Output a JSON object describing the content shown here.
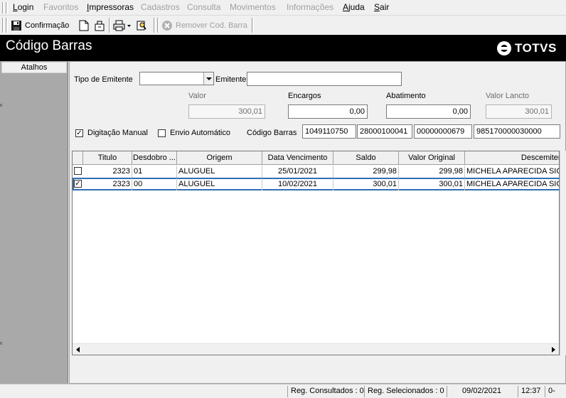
{
  "menu": {
    "items": [
      {
        "label": "Login",
        "underline": "L",
        "rest": "ogin",
        "enabled": true
      },
      {
        "label": "Favoritos",
        "enabled": false
      },
      {
        "label": "Impressoras",
        "underline": "I",
        "rest": "mpressoras",
        "enabled": true
      },
      {
        "label": "Cadastros",
        "enabled": false
      },
      {
        "label": "Consulta",
        "enabled": false
      },
      {
        "label": "Movimentos",
        "enabled": false
      },
      {
        "label": "Informações",
        "enabled": false
      },
      {
        "label": "Ajuda",
        "underline": "A",
        "rest": "juda",
        "enabled": true
      },
      {
        "label": "Sair",
        "underline": "S",
        "rest": "air",
        "enabled": true
      }
    ]
  },
  "toolbar": {
    "confirm_label": "Confirmação",
    "remove_barcode_label": "Remover Cod. Barra",
    "icons": [
      "save-icon",
      "new-document-icon",
      "export-icon",
      "printer-icon",
      "dropdown-arrow-icon",
      "edit-search-icon",
      "remove-icon"
    ]
  },
  "window": {
    "title": "Código Barras",
    "brand": "TOTVS"
  },
  "left_panel": {
    "shortcut_label": "Atalhos"
  },
  "form": {
    "tipo_emitente_label": "Tipo de Emitente",
    "tipo_emitente_value": "",
    "emitente_label": "Emitente",
    "emitente_value": "",
    "valor_label": "Valor",
    "valor_value": "300,01",
    "encargos_label": "Encargos",
    "encargos_value": "0,00",
    "abatimento_label": "Abatimento",
    "abatimento_value": "0,00",
    "valor_lancto_label": "Valor Lancto",
    "valor_lancto_value": "300,01",
    "digitacao_manual_label": "Digitação Manual",
    "digitacao_manual_checked": true,
    "envio_automatico_label": "Envio Automático",
    "envio_automatico_checked": false,
    "codigo_barras_label": "Código Barras",
    "barcode_parts": [
      "1049110750",
      "28000100041",
      "00000000679",
      "985170000030000"
    ]
  },
  "grid": {
    "columns": [
      "Titulo",
      "Desdobro ...",
      "Origem",
      "Data Vencimento",
      "Saldo",
      "Valor Original",
      "Descemiten"
    ],
    "rows": [
      {
        "checked": false,
        "titulo": "2323",
        "desdobro": "01",
        "origem": "ALUGUEL",
        "vencimento": "25/01/2021",
        "saldo": "299,98",
        "valor_original": "299,98",
        "descemitente": "MICHELA APARECIDA SIC"
      },
      {
        "checked": true,
        "titulo": "2323",
        "desdobro": "00",
        "origem": "ALUGUEL",
        "vencimento": "10/02/2021",
        "saldo": "300,01",
        "valor_original": "300,01",
        "descemitente": "MICHELA APARECIDA SIC"
      }
    ]
  },
  "status": {
    "consultados": "Reg. Consultados : 0",
    "selecionados": "Reg. Selecionados : 0",
    "date": "09/02/2021",
    "time": "12:37",
    "extra": "0-"
  }
}
